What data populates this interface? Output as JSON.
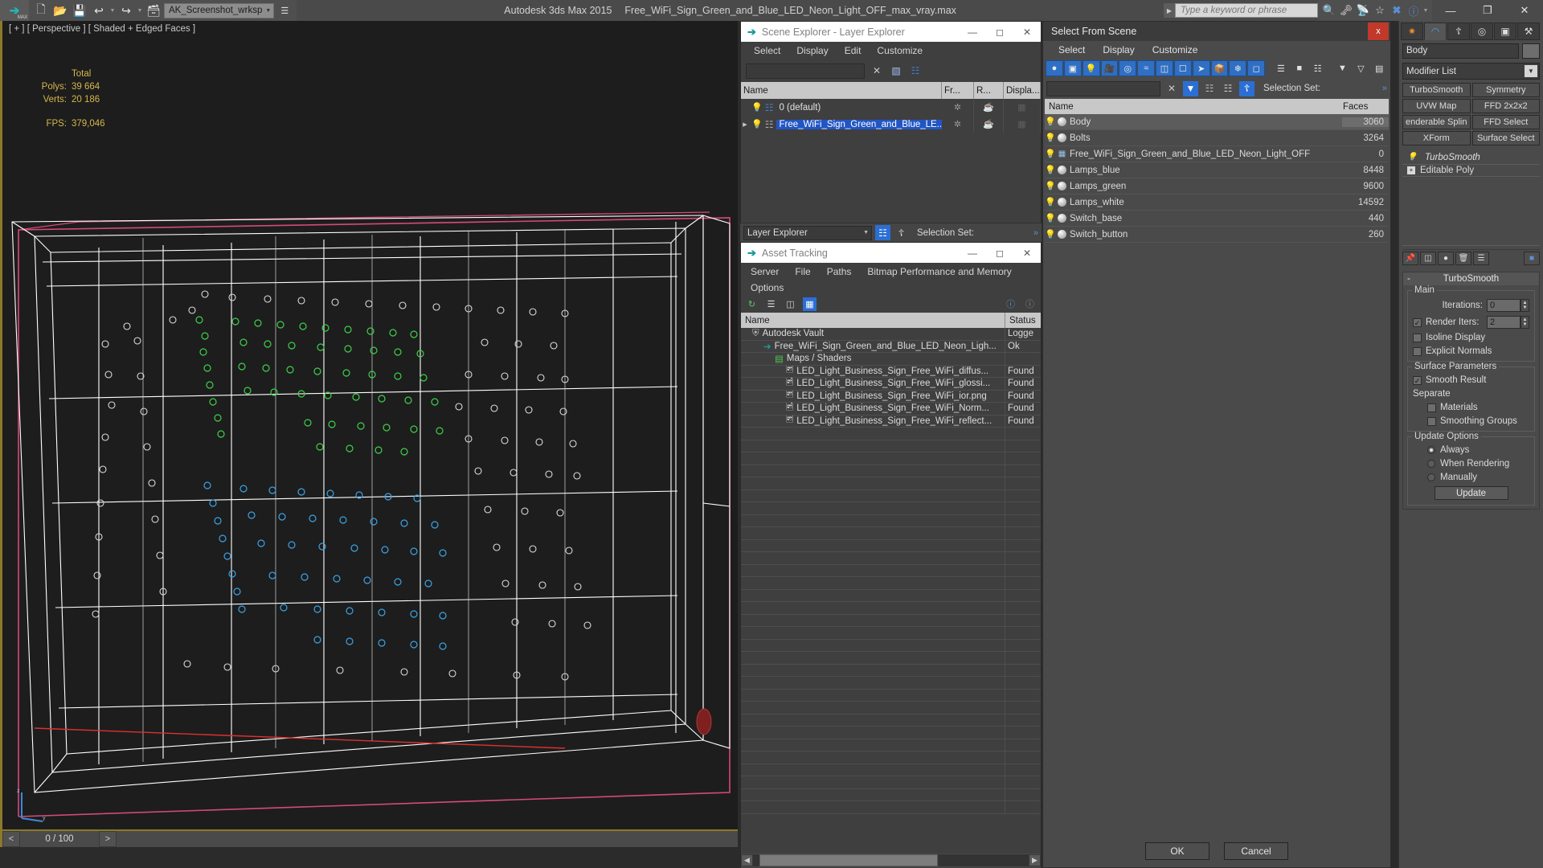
{
  "titlebar": {
    "workspace": "AK_Screenshot_wrksp",
    "app_name": "Autodesk 3ds Max  2015",
    "file_name": "Free_WiFi_Sign_Green_and_Blue_LED_Neon_Light_OFF_max_vray.max",
    "search_placeholder": "Type a keyword or phrase",
    "quick_access": [
      {
        "name": "new-file-icon",
        "glyph": "⬜"
      },
      {
        "name": "open-file-icon",
        "glyph": "📂"
      },
      {
        "name": "save-file-icon",
        "glyph": "💾"
      },
      {
        "name": "undo-icon",
        "glyph": "↩"
      },
      {
        "name": "redo-icon",
        "glyph": "↪"
      },
      {
        "name": "project-folder-icon",
        "glyph": "🗂"
      }
    ],
    "right_tools": [
      {
        "name": "search-binoculars-icon",
        "glyph": "🔎"
      },
      {
        "name": "key-icon",
        "glyph": "🗝"
      },
      {
        "name": "satellite-icon",
        "glyph": "📡"
      },
      {
        "name": "star-icon",
        "glyph": "★"
      },
      {
        "name": "exchange-icon",
        "glyph": "✖"
      },
      {
        "name": "help-icon",
        "glyph": "?"
      }
    ],
    "window_controls": [
      {
        "name": "minimize-button",
        "glyph": "—"
      },
      {
        "name": "restore-button",
        "glyph": "❐"
      },
      {
        "name": "close-button",
        "glyph": "✕"
      }
    ]
  },
  "viewport": {
    "label": "[ + ] [ Perspective ] [ Shaded + Edged Faces ]",
    "stats": {
      "total_header": "Total",
      "polys_label": "Polys:",
      "polys_value": "39 664",
      "verts_label": "Verts:",
      "verts_value": "20 186",
      "fps_label": "FPS:",
      "fps_value": "379,046"
    },
    "axis": {
      "z": "z",
      "y": "y",
      "x": "x"
    },
    "timeline": {
      "prev": "<",
      "value": "0 / 100",
      "next": ">"
    }
  },
  "scene_explorer": {
    "title": "Scene Explorer - Layer Explorer",
    "menus": [
      "Select",
      "Display",
      "Edit",
      "Customize"
    ],
    "columns": [
      "Name",
      "Fr...",
      "R...",
      "Displa..."
    ],
    "rows": [
      {
        "name": "0 (default)",
        "selected": false,
        "expandable": false
      },
      {
        "name": "Free_WiFi_Sign_Green_and_Blue_LE...",
        "selected": true,
        "expandable": true
      }
    ],
    "window_controls": [
      {
        "name": "minimize-button",
        "glyph": "—"
      },
      {
        "name": "maximize-button",
        "glyph": "❑"
      },
      {
        "name": "close-button",
        "glyph": "✕"
      }
    ]
  },
  "layer_explorer_bar": {
    "combo_value": "Layer Explorer",
    "selection_set_label": "Selection Set:",
    "overflow": "»"
  },
  "asset_tracking": {
    "title": "Asset Tracking",
    "menus": [
      "Server",
      "File",
      "Paths",
      "Bitmap Performance and Memory",
      "Options"
    ],
    "columns": [
      "Name",
      "Status"
    ],
    "rows": [
      {
        "name": "Autodesk Vault",
        "status": "Logge",
        "indent": 0,
        "icon": "vault-icon"
      },
      {
        "name": "Free_WiFi_Sign_Green_and_Blue_LED_Neon_Ligh...",
        "status": "Ok",
        "indent": 1,
        "icon": "max-file-icon"
      },
      {
        "name": "Maps / Shaders",
        "status": "",
        "indent": 2,
        "icon": "maps-icon"
      },
      {
        "name": "LED_Light_Business_Sign_Free_WiFi_diffus...",
        "status": "Found",
        "indent": 3,
        "icon": "bitmap-icon"
      },
      {
        "name": "LED_Light_Business_Sign_Free_WiFi_glossi...",
        "status": "Found",
        "indent": 3,
        "icon": "bitmap-icon"
      },
      {
        "name": "LED_Light_Business_Sign_Free_WiFi_ior.png",
        "status": "Found",
        "indent": 3,
        "icon": "bitmap-icon"
      },
      {
        "name": "LED_Light_Business_Sign_Free_WiFi_Norm...",
        "status": "Found",
        "indent": 3,
        "icon": "bitmap-icon"
      },
      {
        "name": "LED_Light_Business_Sign_Free_WiFi_reflect...",
        "status": "Found",
        "indent": 3,
        "icon": "bitmap-icon"
      }
    ],
    "window_controls": [
      {
        "name": "minimize-button",
        "glyph": "—"
      },
      {
        "name": "maximize-button",
        "glyph": "❑"
      },
      {
        "name": "close-button",
        "glyph": "✕"
      }
    ]
  },
  "select_from_scene": {
    "title": "Select From Scene",
    "close_glyph": "x",
    "menus": [
      "Select",
      "Display",
      "Customize"
    ],
    "filter_label": "Selection Set:",
    "columns": [
      "Name",
      "Faces"
    ],
    "rows": [
      {
        "name": "Body",
        "faces": "3060",
        "selected": true,
        "icon": "geometry-orb-icon"
      },
      {
        "name": "Bolts",
        "faces": "3264",
        "selected": false,
        "icon": "geometry-orb-icon"
      },
      {
        "name": "Free_WiFi_Sign_Green_and_Blue_LED_Neon_Light_OFF",
        "faces": "0",
        "selected": false,
        "icon": "group-icon"
      },
      {
        "name": "Lamps_blue",
        "faces": "8448",
        "selected": false,
        "icon": "geometry-orb-icon"
      },
      {
        "name": "Lamps_green",
        "faces": "9600",
        "selected": false,
        "icon": "geometry-orb-icon"
      },
      {
        "name": "Lamps_white",
        "faces": "14592",
        "selected": false,
        "icon": "geometry-orb-icon"
      },
      {
        "name": "Switch_base",
        "faces": "440",
        "selected": false,
        "icon": "geometry-orb-icon"
      },
      {
        "name": "Switch_button",
        "faces": "260",
        "selected": false,
        "icon": "geometry-orb-icon"
      }
    ],
    "ok_label": "OK",
    "cancel_label": "Cancel"
  },
  "command_panel": {
    "tabs": [
      {
        "name": "create-tab",
        "glyph": "✹",
        "active": false
      },
      {
        "name": "modify-tab",
        "glyph": "◠",
        "active": true
      },
      {
        "name": "hierarchy-tab",
        "glyph": "⑂",
        "active": false
      },
      {
        "name": "motion-tab",
        "glyph": "◎",
        "active": false
      },
      {
        "name": "display-tab",
        "glyph": "▣",
        "active": false
      },
      {
        "name": "utilities-tab",
        "glyph": "⚒",
        "active": false
      }
    ],
    "object_name": "Body",
    "modifier_list_label": "Modifier List",
    "modifier_buttons": [
      "TurboSmooth",
      "Symmetry",
      "UVW Map",
      "FFD 2x2x2",
      "enderable Splin",
      "FFD Select",
      "XForm",
      "Surface Select"
    ],
    "stack": [
      {
        "label": "TurboSmooth",
        "italic": true
      },
      {
        "label": "Editable Poly",
        "italic": false
      }
    ],
    "rollout": {
      "title": "TurboSmooth",
      "collapse_glyph": "-",
      "main_group": "Main",
      "iterations_label": "Iterations:",
      "iterations_value": "0",
      "render_iters_label": "Render Iters:",
      "render_iters_value": "2",
      "render_iters_checked": true,
      "isoline_label": "Isoline Display",
      "isoline_checked": false,
      "explicit_normals_label": "Explicit Normals",
      "explicit_normals_checked": false,
      "surface_group": "Surface Parameters",
      "smooth_result_label": "Smooth Result",
      "smooth_result_checked": true,
      "separate_label": "Separate",
      "materials_label": "Materials",
      "materials_checked": false,
      "smoothing_groups_label": "Smoothing Groups",
      "smoothing_groups_checked": false,
      "update_group": "Update Options",
      "always_label": "Always",
      "when_rendering_label": "When Rendering",
      "manually_label": "Manually",
      "update_button": "Update",
      "selected_update": "Always"
    }
  },
  "colors": {
    "accent_blue": "#2f6fc4",
    "selection_blue": "#2255c4",
    "gold": "#d6b64a",
    "close_red": "#c0392b",
    "green_led": "#3fd14a",
    "blue_led": "#3ba3e8",
    "white_led": "#e8e8e8"
  }
}
